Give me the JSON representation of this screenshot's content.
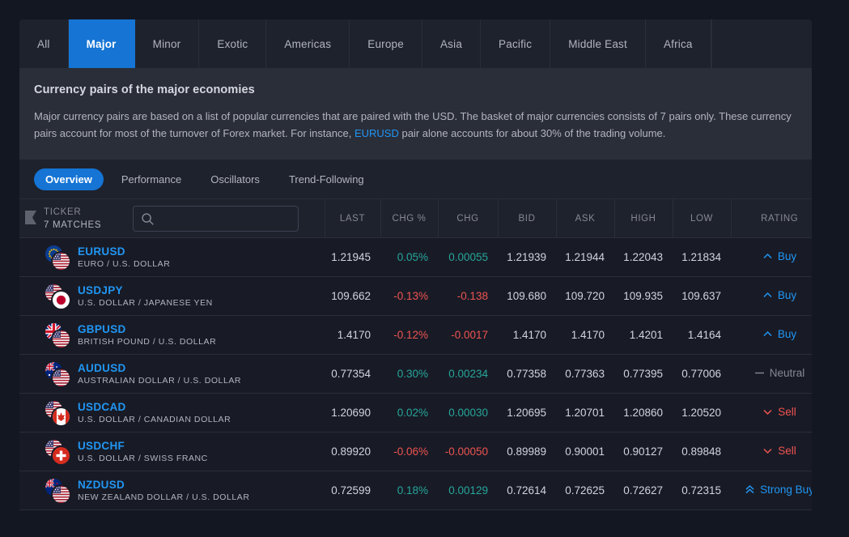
{
  "category_tabs": [
    {
      "label": "All",
      "active": false
    },
    {
      "label": "Major",
      "active": true
    },
    {
      "label": "Minor",
      "active": false
    },
    {
      "label": "Exotic",
      "active": false
    },
    {
      "label": "Americas",
      "active": false
    },
    {
      "label": "Europe",
      "active": false
    },
    {
      "label": "Asia",
      "active": false
    },
    {
      "label": "Pacific",
      "active": false
    },
    {
      "label": "Middle East",
      "active": false
    },
    {
      "label": "Africa",
      "active": false
    }
  ],
  "description": {
    "title": "Currency pairs of the major economies",
    "text_before_link": "Major currency pairs are based on a list of popular currencies that are paired with the USD. The basket of major currencies consists of 7 pairs only. These currency pairs account for most of the turnover of Forex market. For instance, ",
    "link": "EURUSD",
    "text_after_link": " pair alone accounts for about 30% of the trading volume."
  },
  "sub_tabs": [
    {
      "label": "Overview",
      "active": true
    },
    {
      "label": "Performance",
      "active": false
    },
    {
      "label": "Oscillators",
      "active": false
    },
    {
      "label": "Trend-Following",
      "active": false
    }
  ],
  "table": {
    "ticker_header": "TICKER",
    "matches": "7 MATCHES",
    "search": {
      "value": "",
      "placeholder": ""
    },
    "columns": [
      "LAST",
      "CHG %",
      "CHG",
      "BID",
      "ASK",
      "HIGH",
      "LOW",
      "RATING"
    ],
    "rows": [
      {
        "symbol": "EURUSD",
        "name": "EURO / U.S. DOLLAR",
        "flag_back": "f-eu",
        "flag_front": "f-us",
        "last": "1.21945",
        "chg_pct": "0.05%",
        "chg": "0.00055",
        "bid": "1.21939",
        "ask": "1.21944",
        "high": "1.22043",
        "low": "1.21834",
        "direction": "up",
        "rating": "Buy",
        "rating_kind": "buy"
      },
      {
        "symbol": "USDJPY",
        "name": "U.S. DOLLAR / JAPANESE YEN",
        "flag_back": "f-us",
        "flag_front": "f-jp",
        "last": "109.662",
        "chg_pct": "-0.13%",
        "chg": "-0.138",
        "bid": "109.680",
        "ask": "109.720",
        "high": "109.935",
        "low": "109.637",
        "direction": "down",
        "rating": "Buy",
        "rating_kind": "buy"
      },
      {
        "symbol": "GBPUSD",
        "name": "BRITISH POUND / U.S. DOLLAR",
        "flag_back": "f-gb",
        "flag_front": "f-us",
        "last": "1.4170",
        "chg_pct": "-0.12%",
        "chg": "-0.0017",
        "bid": "1.4170",
        "ask": "1.4170",
        "high": "1.4201",
        "low": "1.4164",
        "direction": "down",
        "rating": "Buy",
        "rating_kind": "buy"
      },
      {
        "symbol": "AUDUSD",
        "name": "AUSTRALIAN DOLLAR / U.S. DOLLAR",
        "flag_back": "f-au",
        "flag_front": "f-us",
        "last": "0.77354",
        "chg_pct": "0.30%",
        "chg": "0.00234",
        "bid": "0.77358",
        "ask": "0.77363",
        "high": "0.77395",
        "low": "0.77006",
        "direction": "up",
        "rating": "Neutral",
        "rating_kind": "neutral"
      },
      {
        "symbol": "USDCAD",
        "name": "U.S. DOLLAR / CANADIAN DOLLAR",
        "flag_back": "f-us",
        "flag_front": "f-ca",
        "last": "1.20690",
        "chg_pct": "0.02%",
        "chg": "0.00030",
        "bid": "1.20695",
        "ask": "1.20701",
        "high": "1.20860",
        "low": "1.20520",
        "direction": "up",
        "rating": "Sell",
        "rating_kind": "sell"
      },
      {
        "symbol": "USDCHF",
        "name": "U.S. DOLLAR / SWISS FRANC",
        "flag_back": "f-us",
        "flag_front": "f-ch",
        "last": "0.89920",
        "chg_pct": "-0.06%",
        "chg": "-0.00050",
        "bid": "0.89989",
        "ask": "0.90001",
        "high": "0.90127",
        "low": "0.89848",
        "direction": "down",
        "rating": "Sell",
        "rating_kind": "sell"
      },
      {
        "symbol": "NZDUSD",
        "name": "NEW ZEALAND DOLLAR / U.S. DOLLAR",
        "flag_back": "f-nz",
        "flag_front": "f-us",
        "last": "0.72599",
        "chg_pct": "0.18%",
        "chg": "0.00129",
        "bid": "0.72614",
        "ask": "0.72625",
        "high": "0.72627",
        "low": "0.72315",
        "direction": "up",
        "rating": "Strong Buy",
        "rating_kind": "strong-buy"
      }
    ]
  },
  "colors": {
    "page_bg": "#131722",
    "card_bg": "#1e222d",
    "panel_bg": "#2a2e39",
    "row_bg": "#181b26",
    "accent": "#1574d4",
    "link": "#2196f3",
    "positive": "#26a69a",
    "negative": "#ef5350",
    "neutral": "#868993",
    "border": "#2a2e39"
  },
  "icons": {
    "search": "search-icon",
    "bookmark": "bookmark-ribbon-icon",
    "chevron_up": "chevron-up-icon",
    "chevron_down": "chevron-down-icon",
    "double_chevron_up": "double-chevron-up-icon",
    "dash": "dash-icon"
  }
}
